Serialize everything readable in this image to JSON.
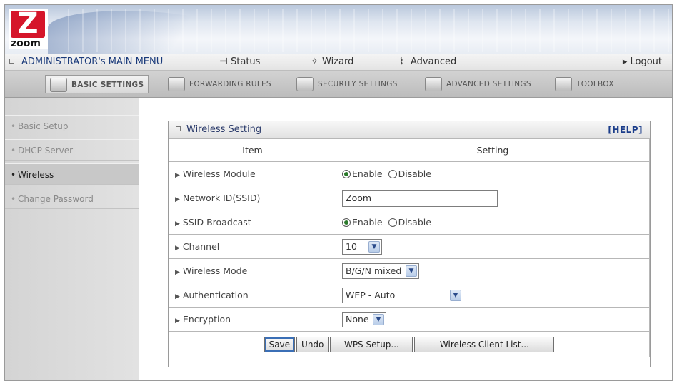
{
  "logo": {
    "text": "zoom",
    "mark": "Z"
  },
  "main_menu": {
    "title": "ADMINISTRATOR's MAIN MENU",
    "status": "Status",
    "wizard": "Wizard",
    "advanced": "Advanced",
    "logout": "Logout"
  },
  "tabs": [
    {
      "label": "BASIC SETTINGS",
      "active": true
    },
    {
      "label": "FORWARDING RULES",
      "active": false
    },
    {
      "label": "SECURITY SETTINGS",
      "active": false
    },
    {
      "label": "ADVANCED SETTINGS",
      "active": false
    },
    {
      "label": "TOOLBOX",
      "active": false
    }
  ],
  "sidebar": {
    "items": [
      {
        "label": "Basic Setup",
        "active": false
      },
      {
        "label": "DHCP Server",
        "active": false
      },
      {
        "label": "Wireless",
        "active": true
      },
      {
        "label": "Change Password",
        "active": false
      }
    ]
  },
  "panel": {
    "title": "Wireless Setting",
    "help": "[HELP]",
    "col_item": "Item",
    "col_setting": "Setting",
    "rows": {
      "module": {
        "label": "Wireless Module",
        "opt1": "Enable",
        "opt2": "Disable",
        "selected": "Enable"
      },
      "ssid": {
        "label": "Network ID(SSID)",
        "value": "Zoom"
      },
      "broadcast": {
        "label": "SSID Broadcast",
        "opt1": "Enable",
        "opt2": "Disable",
        "selected": "Enable"
      },
      "channel": {
        "label": "Channel",
        "value": "10"
      },
      "mode": {
        "label": "Wireless Mode",
        "value": "B/G/N mixed"
      },
      "auth": {
        "label": "Authentication",
        "value": "WEP - Auto"
      },
      "encryption": {
        "label": "Encryption",
        "value": "None"
      }
    },
    "buttons": {
      "save": "Save",
      "undo": "Undo",
      "wps": "WPS Setup...",
      "clients": "Wireless Client List..."
    }
  },
  "colors": {
    "accent_red": "#d5152a",
    "link_blue": "#1b3d8a",
    "radio_green": "#2a7a2a"
  }
}
